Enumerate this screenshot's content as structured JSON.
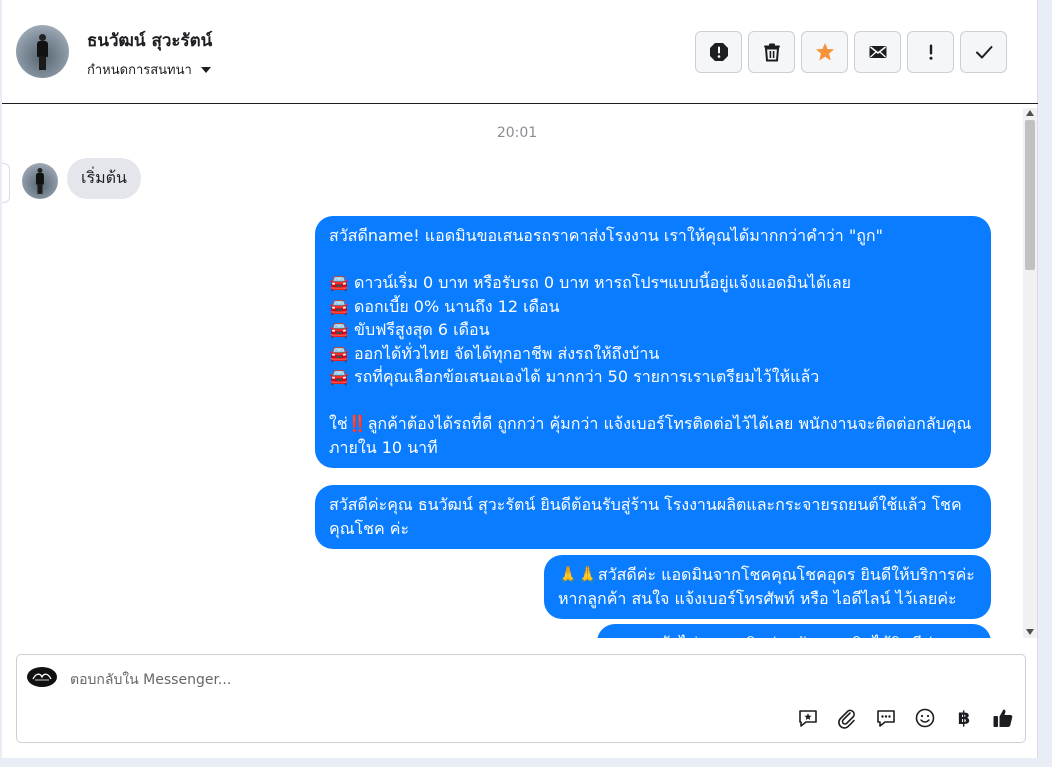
{
  "header": {
    "contact_name": "ธนวัฒน์ สุวะรัตน์",
    "settings_label": "กำหนดการสนทนา",
    "actions": [
      {
        "name": "report-spam-icon"
      },
      {
        "name": "trash-icon"
      },
      {
        "name": "star-icon",
        "color": "#f7923b"
      },
      {
        "name": "mail-icon"
      },
      {
        "name": "mark-important-icon"
      },
      {
        "name": "checkmark-icon"
      }
    ]
  },
  "chat": {
    "timestamp": "20:01",
    "incoming": [
      {
        "text": "เริ่มต้น"
      }
    ],
    "outgoing": [
      {
        "text": "สวัสดีname! แอดมินขอเสนอรถราคาส่งโรงงาน เราให้คุณได้มากกว่าคำว่า \"ถูก\"\n\n🚘 ดาวน์เริ่ม 0 บาท หรือรับรถ 0 บาท หารถโปรฯแบบนี้อยู่แจ้งแอดมินได้เลย\n🚘 ดอกเบี้ย 0% นานถึง 12 เดือน\n🚘 ขับฟรีสูงสุด 6 เดือน\n🚘 ออกได้ทั่วไทย จัดได้ทุกอาชีพ ส่งรถให้ถึงบ้าน\n🚘 รถที่คุณเลือกข้อเสนอเองได้ มากกว่า 50 รายการเราเตรียมไว้ให้แล้ว\n\nใช่‼️ลูกค้าต้องได้รถที่ดี ถูกกว่า คุ้มกว่า แจ้งเบอร์โทรติดต่อไว้ได้เลย พนักงานจะติดต่อกลับคุณภายใน 10 นาที"
      },
      {
        "text": "สวัสดีค่ะคุณ ธนวัฒน์ สุวะรัตน์ ยินดีต้อนรับสู่ร้าน โรงงานผลิตและกระจายรถยนต์ใช้แล้ว โชคคุณโชค ค่ะ"
      },
      {
        "text": "🙏🙏สวัสดีค่ะ แอดมินจากโชคคุณโชคอุดร ยินดีให้บริการค่ะ หากลูกค้า สนใจ แจ้งเบอร์โทรศัพท์ หรือ ไอดีไลน์  ไว้เลยค่ะ"
      },
      {
        "text": "หากลูกค้าไม่สะดวกติดต่อกลับ แอดมินได้ยินดีค่ะ"
      }
    ]
  },
  "composer": {
    "placeholder": "ตอบกลับใน Messenger...",
    "tools": [
      {
        "name": "saved-reply-icon"
      },
      {
        "name": "attachment-icon"
      },
      {
        "name": "quick-reply-icon"
      },
      {
        "name": "emoji-icon"
      },
      {
        "name": "baht-icon",
        "glyph": "฿"
      },
      {
        "name": "like-icon"
      }
    ]
  },
  "colors": {
    "outgoing_bubble": "#0a7cff",
    "incoming_bubble": "#e4e6eb",
    "star": "#f7923b"
  }
}
